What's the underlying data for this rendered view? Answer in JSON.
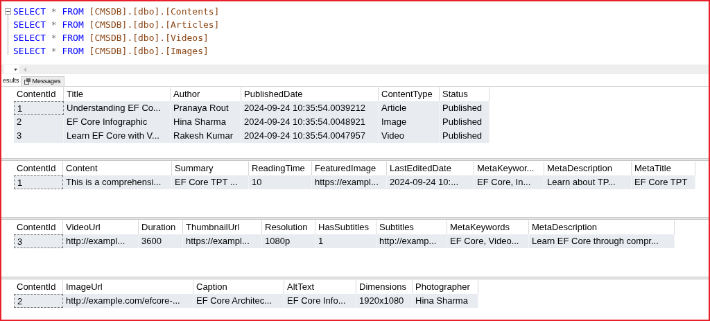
{
  "query_lines": [
    {
      "keyword": "SELECT",
      "star": "*",
      "from": "FROM",
      "target": "[CMSDB].[dbo].[Contents]"
    },
    {
      "keyword": "SELECT",
      "star": "*",
      "from": "FROM",
      "target": "[CMSDB].[dbo].[Articles]"
    },
    {
      "keyword": "SELECT",
      "star": "*",
      "from": "FROM",
      "target": "[CMSDB].[dbo].[Videos]"
    },
    {
      "keyword": "SELECT",
      "star": "*",
      "from": "FROM",
      "target": "[CMSDB].[dbo].[Images]"
    }
  ],
  "result_tabs": [
    {
      "label": "esults",
      "selected": true
    },
    {
      "label": "Messages",
      "selected": false
    }
  ],
  "grids": [
    {
      "columns": [
        "ContentId",
        "Title",
        "Author",
        "PublishedDate",
        "ContentType",
        "Status"
      ],
      "rows": [
        [
          "1",
          "Understanding EF Co...",
          "Pranaya Rout",
          "2024-09-24 10:35:54.0039212",
          "Article",
          "Published"
        ],
        [
          "2",
          "EF Core Infographic",
          "Hina Sharma",
          "2024-09-24 10:35:54.0048921",
          "Image",
          "Published"
        ],
        [
          "3",
          "Learn EF Core with V...",
          "Rakesh Kumar",
          "2024-09-24 10:35:54.0047957",
          "Video",
          "Published"
        ]
      ]
    },
    {
      "columns": [
        "ContentId",
        "Content",
        "Summary",
        "ReadingTime",
        "FeaturedImage",
        "LastEditedDate",
        "MetaKeywor...",
        "MetaDescription",
        "MetaTitle"
      ],
      "rows": [
        [
          "1",
          "This is a comprehensi...",
          "EF Core TPT ...",
          "10",
          "https://exampl...",
          "2024-09-24 10:...",
          "EF Core, In...",
          "Learn about TP...",
          "EF Core TPT"
        ]
      ]
    },
    {
      "columns": [
        "ContentId",
        "VideoUrl",
        "Duration",
        "ThumbnailUrl",
        "Resolution",
        "HasSubtitles",
        "Subtitles",
        "MetaKeywords",
        "MetaDescription"
      ],
      "rows": [
        [
          "3",
          "http://exampl...",
          "3600",
          "https://exampl...",
          "1080p",
          "1",
          "http://examp...",
          "EF Core, Video...",
          "Learn EF Core through compr..."
        ]
      ]
    },
    {
      "columns": [
        "ContentId",
        "ImageUrl",
        "Caption",
        "AltText",
        "Dimensions",
        "Photographer"
      ],
      "rows": [
        [
          "2",
          "http://example.com/efcore-...",
          "EF Core Architec...",
          "EF Core Info...",
          "1920x1080",
          "Hina Sharma"
        ]
      ]
    }
  ]
}
